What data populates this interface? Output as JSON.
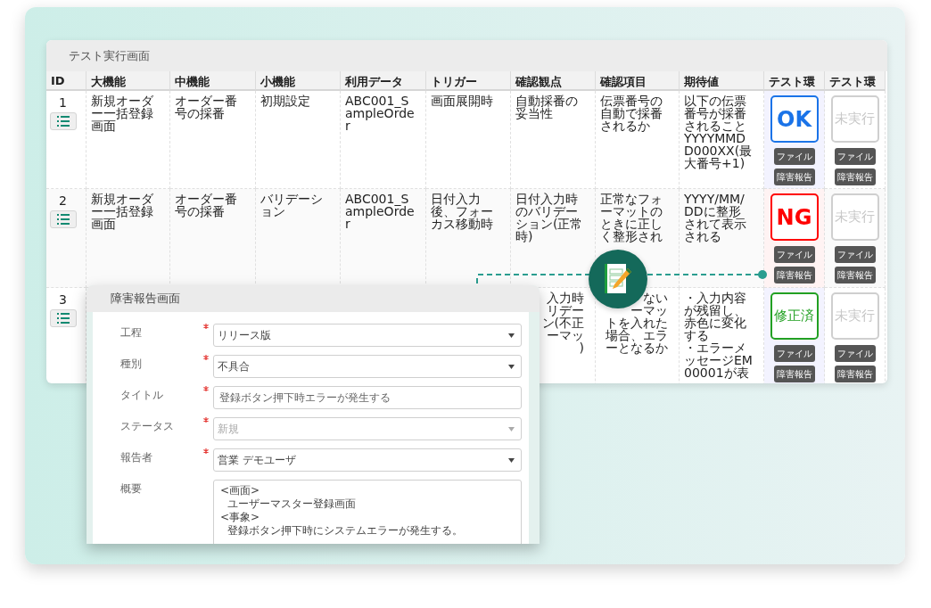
{
  "screen": {
    "title": "テスト実行画面",
    "table": {
      "columns": [
        "ID",
        "大機能",
        "中機能",
        "小機能",
        "利用データ",
        "トリガー",
        "確認観点",
        "確認項目",
        "期待値",
        "テスト環",
        "テスト環"
      ],
      "rows": [
        {
          "cells": [
            {
              "kind": "id",
              "text": "1"
            },
            {
              "kind": "text",
              "text": "新規オーダー一括登録画面"
            },
            {
              "kind": "text",
              "text": "オーダー番号の採番"
            },
            {
              "kind": "text",
              "text": "初期設定"
            },
            {
              "kind": "text",
              "text": "ABC001_SampleOrder"
            },
            {
              "kind": "text",
              "text": "画面展開時"
            },
            {
              "kind": "text",
              "text": "自動採番の妥当性"
            },
            {
              "kind": "text",
              "text": "伝票番号の自動で採番されるか"
            },
            {
              "kind": "text",
              "text": "以下の伝票番号が採番されることYYYYMMDD000XX(最大番号+1)"
            },
            {
              "kind": "ok",
              "label": "OK",
              "file": "ファイル",
              "report": "障害報告"
            },
            {
              "kind": "none",
              "label": "未実行",
              "file": "ファイル",
              "report": "障害報告"
            }
          ]
        },
        {
          "cells": [
            {
              "kind": "id",
              "text": "2"
            },
            {
              "kind": "text",
              "text": "新規オーダー一括登録画面"
            },
            {
              "kind": "text",
              "text": "オーダー番号の採番"
            },
            {
              "kind": "text",
              "text": "バリデーション"
            },
            {
              "kind": "text",
              "text": "ABC001_SampleOrder"
            },
            {
              "kind": "text",
              "text": "日付入力後、フォーカス移動時"
            },
            {
              "kind": "text",
              "text": "日付入力時のバリデーション(正常時)"
            },
            {
              "kind": "text",
              "text": "正常なフォーマットのときに正しく整形され"
            },
            {
              "kind": "text",
              "text": "YYYY/MM/DDに整形されて表示される"
            },
            {
              "kind": "ng",
              "label": "NG",
              "file": "ファイル",
              "report": "障害報告"
            },
            {
              "kind": "none",
              "label": "未実行",
              "file": "ファイル",
              "report": "障害報告"
            }
          ]
        },
        {
          "cells": [
            {
              "kind": "id",
              "text": "3"
            },
            "",
            "",
            "",
            "",
            "",
            {
              "kind": "fragments",
              "lines": [
                "入力時",
                "リデー",
                "ン(不正",
                "ーマッ",
                ")"
              ]
            },
            {
              "kind": "fragments",
              "lines": [
                "ない",
                "ーマッ",
                "トを入れた",
                "場合、エラ",
                "ーとなるか"
              ]
            },
            {
              "kind": "list",
              "lines": [
                "・入力内容が残留し、赤色に変化する",
                "・エラーメッセージEM00001が表"
              ]
            },
            {
              "kind": "fixed",
              "label": "修正済",
              "file": "ファイル",
              "report": "障害報告"
            },
            {
              "kind": "none",
              "label": "未実行",
              "file": "ファイル",
              "report": "障害報告"
            }
          ]
        }
      ]
    }
  },
  "dialog": {
    "title": "障害報告画面",
    "fields": [
      {
        "label": "工程",
        "required": true,
        "kind": "select",
        "value": "リリース版",
        "disabled": false
      },
      {
        "label": "種別",
        "required": true,
        "kind": "select",
        "value": "不具合",
        "disabled": false
      },
      {
        "label": "タイトル",
        "required": true,
        "kind": "text",
        "value": "登録ボタン押下時エラーが発生する",
        "disabled": false
      },
      {
        "label": "ステータス",
        "required": true,
        "kind": "select",
        "value": "新規",
        "disabled": true
      },
      {
        "label": "報告者",
        "required": true,
        "kind": "select",
        "value": "営業 デモユーザ",
        "disabled": false
      },
      {
        "label": "概要",
        "required": false,
        "kind": "textarea",
        "value": "<画面>\n  ユーザーマスター登録画面\n<事象>\n  登録ボタン押下時にシステムエラーが発生する。",
        "disabled": false
      }
    ]
  }
}
